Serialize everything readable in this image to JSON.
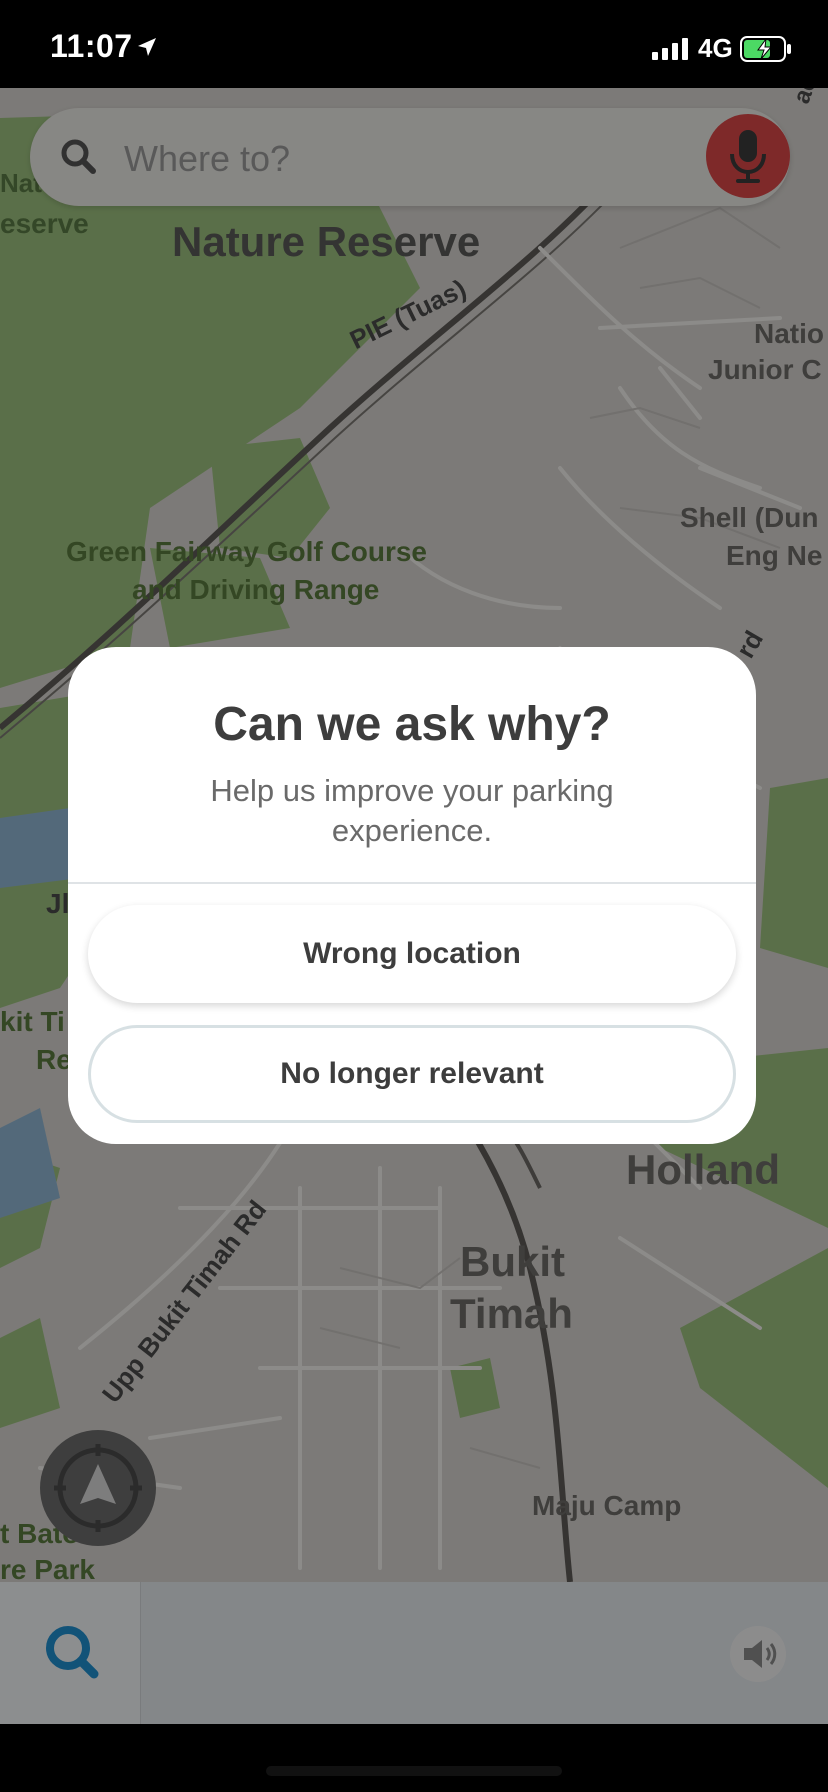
{
  "status_bar": {
    "time": "11:07",
    "network": "4G",
    "icons": [
      "location-arrow-icon",
      "signal-bars-icon",
      "battery-charging-icon"
    ]
  },
  "search": {
    "placeholder": "Where to?",
    "icons": [
      "search-icon",
      "microphone-icon"
    ]
  },
  "map": {
    "labels": {
      "nature_reserve": "Nature Reserve",
      "nature_reserve_left_1": "Natu",
      "nature_reserve_left_2": "eserve",
      "pie": "PIE (Tuas)",
      "national_jc_1": "Natio",
      "national_jc_2": "Junior C",
      "shell_1": "Shell (Dun",
      "shell_2": "Eng Ne",
      "golf_1": "Green Fairway Golf Course",
      "golf_2": "and Driving Range",
      "rd": "rd",
      "jl": "Jl",
      "kit_ti_1": "kit Ti",
      "kit_ti_2": "Re",
      "holland": "Holland",
      "upp_bukit_timah": "Upp Bukit Timah Rd",
      "bukit": "Bukit",
      "timah": "Timah",
      "maju_camp": "Maju Camp",
      "batok_1": "t Batok",
      "batok_2": "re Park",
      "top_right": "ac"
    }
  },
  "modal": {
    "title": "Can we ask why?",
    "subtitle": "Help us improve your parking experience.",
    "options": [
      "Wrong location",
      "No longer relevant"
    ]
  },
  "bottom_bar": {
    "icons": [
      "search-icon",
      "speaker-icon"
    ]
  },
  "colors": {
    "mic_red": "#d94848",
    "search_blue": "#1f8fcf",
    "title_text": "#3d3d3d"
  }
}
